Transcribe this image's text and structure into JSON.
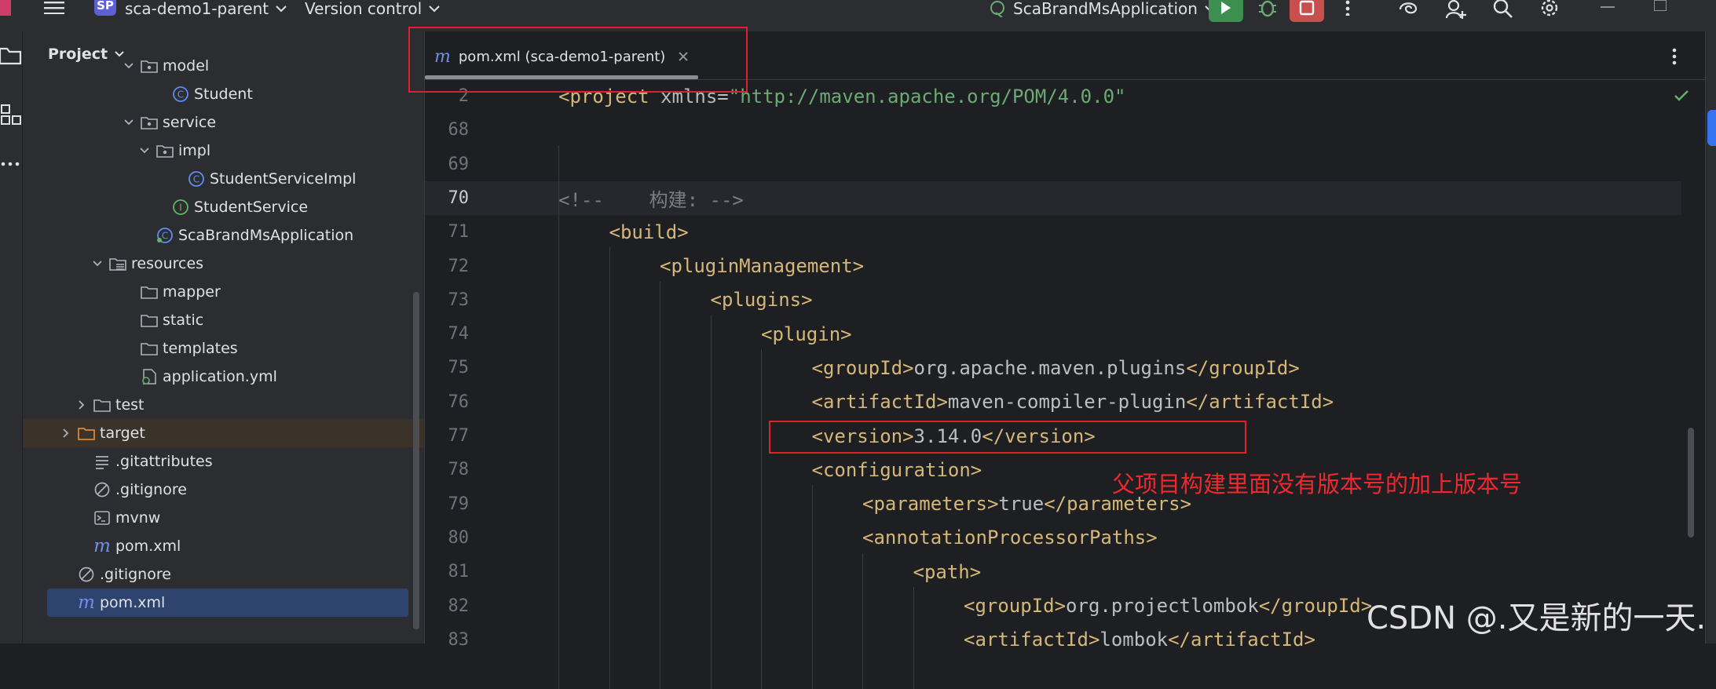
{
  "titlebar": {
    "project_badge": "SP",
    "project_name": "sca-demo1-parent",
    "version_control": "Version control",
    "run_config": "ScaBrandMsApplication"
  },
  "project_panel": {
    "title": "Project",
    "tree": [
      {
        "label": "model",
        "kind": "package",
        "depth": 6,
        "expanded": true
      },
      {
        "label": "Student",
        "kind": "class",
        "depth": 8
      },
      {
        "label": "service",
        "kind": "package",
        "depth": 6,
        "expanded": true
      },
      {
        "label": "impl",
        "kind": "package",
        "depth": 7,
        "expanded": true
      },
      {
        "label": "StudentServiceImpl",
        "kind": "class",
        "depth": 9
      },
      {
        "label": "StudentService",
        "kind": "interface",
        "depth": 8
      },
      {
        "label": "ScaBrandMsApplication",
        "kind": "springboot-class",
        "depth": 7
      },
      {
        "label": "resources",
        "kind": "resources-folder",
        "depth": 4,
        "expanded": true
      },
      {
        "label": "mapper",
        "kind": "folder",
        "depth": 6
      },
      {
        "label": "static",
        "kind": "folder",
        "depth": 6
      },
      {
        "label": "templates",
        "kind": "folder",
        "depth": 6
      },
      {
        "label": "application.yml",
        "kind": "yml",
        "depth": 6
      },
      {
        "label": "test",
        "kind": "folder",
        "depth": 3,
        "expanded": false
      },
      {
        "label": "target",
        "kind": "excluded-folder",
        "depth": 2,
        "expanded": false
      },
      {
        "label": ".gitattributes",
        "kind": "text-file",
        "depth": 3
      },
      {
        "label": ".gitignore",
        "kind": "ignore-file",
        "depth": 3
      },
      {
        "label": "mvnw",
        "kind": "script-file",
        "depth": 3
      },
      {
        "label": "pom.xml",
        "kind": "maven-file",
        "depth": 3
      },
      {
        "label": ".gitignore",
        "kind": "ignore-file",
        "depth": 2
      },
      {
        "label": "pom.xml",
        "kind": "maven-file",
        "depth": 2,
        "selected": true
      }
    ]
  },
  "editor": {
    "tab_label": "pom.xml (sca-demo1-parent)",
    "lines": [
      {
        "n": "2",
        "indent": 0,
        "segments": [
          [
            "tag",
            "<project "
          ],
          [
            "attr",
            "xmlns"
          ],
          [
            "txt",
            "="
          ],
          [
            "str",
            "\"http://maven.apache.org/POM/4.0.0\""
          ]
        ]
      },
      {
        "n": "68",
        "indent": 0,
        "segments": []
      },
      {
        "n": "69",
        "indent": 0,
        "segments": []
      },
      {
        "n": "70",
        "indent": 0,
        "current": true,
        "segments": [
          [
            "cmt",
            "<!--    构建: -->"
          ]
        ]
      },
      {
        "n": "71",
        "indent": 1,
        "segments": [
          [
            "tag",
            "<build>"
          ]
        ]
      },
      {
        "n": "72",
        "indent": 2,
        "segments": [
          [
            "tag",
            "<pluginManagement>"
          ]
        ]
      },
      {
        "n": "73",
        "indent": 3,
        "segments": [
          [
            "tag",
            "<plugins>"
          ]
        ]
      },
      {
        "n": "74",
        "indent": 4,
        "segments": [
          [
            "tag",
            "<plugin>"
          ]
        ]
      },
      {
        "n": "75",
        "indent": 5,
        "segments": [
          [
            "tag",
            "<groupId>"
          ],
          [
            "txt",
            "org.apache.maven.plugins"
          ],
          [
            "tag",
            "</groupId>"
          ]
        ]
      },
      {
        "n": "76",
        "indent": 5,
        "segments": [
          [
            "tag",
            "<artifactId>"
          ],
          [
            "txt",
            "maven-compiler-plugin"
          ],
          [
            "tag",
            "</artifactId>"
          ]
        ]
      },
      {
        "n": "77",
        "indent": 5,
        "segments": [
          [
            "tag",
            "<version>"
          ],
          [
            "txt",
            "3.14.0"
          ],
          [
            "tag",
            "</version>"
          ]
        ]
      },
      {
        "n": "78",
        "indent": 5,
        "segments": [
          [
            "tag",
            "<configuration>"
          ]
        ]
      },
      {
        "n": "79",
        "indent": 6,
        "segments": [
          [
            "tag",
            "<parameters>"
          ],
          [
            "txt",
            "true"
          ],
          [
            "tag",
            "</parameters>"
          ]
        ]
      },
      {
        "n": "80",
        "indent": 6,
        "segments": [
          [
            "tag",
            "<annotationProcessorPaths>"
          ]
        ]
      },
      {
        "n": "81",
        "indent": 7,
        "segments": [
          [
            "tag",
            "<path>"
          ]
        ]
      },
      {
        "n": "82",
        "indent": 8,
        "segments": [
          [
            "tag",
            "<groupId>"
          ],
          [
            "txt",
            "org.projectlombok"
          ],
          [
            "tag",
            "</groupId>"
          ]
        ]
      },
      {
        "n": "83",
        "indent": 8,
        "segments": [
          [
            "tag",
            "<artifactId>"
          ],
          [
            "txt",
            "lombok"
          ],
          [
            "tag",
            "</artifactId>"
          ]
        ]
      }
    ]
  },
  "annotation": "父项目构建里面没有版本号的加上版本号",
  "watermark": "CSDN @.又是新的一天.",
  "colors": {
    "tag": "#d5b778",
    "string": "#6aab73",
    "comment": "#7a7e85",
    "annotation_red": "#e0202a",
    "selection": "#2e436e"
  }
}
